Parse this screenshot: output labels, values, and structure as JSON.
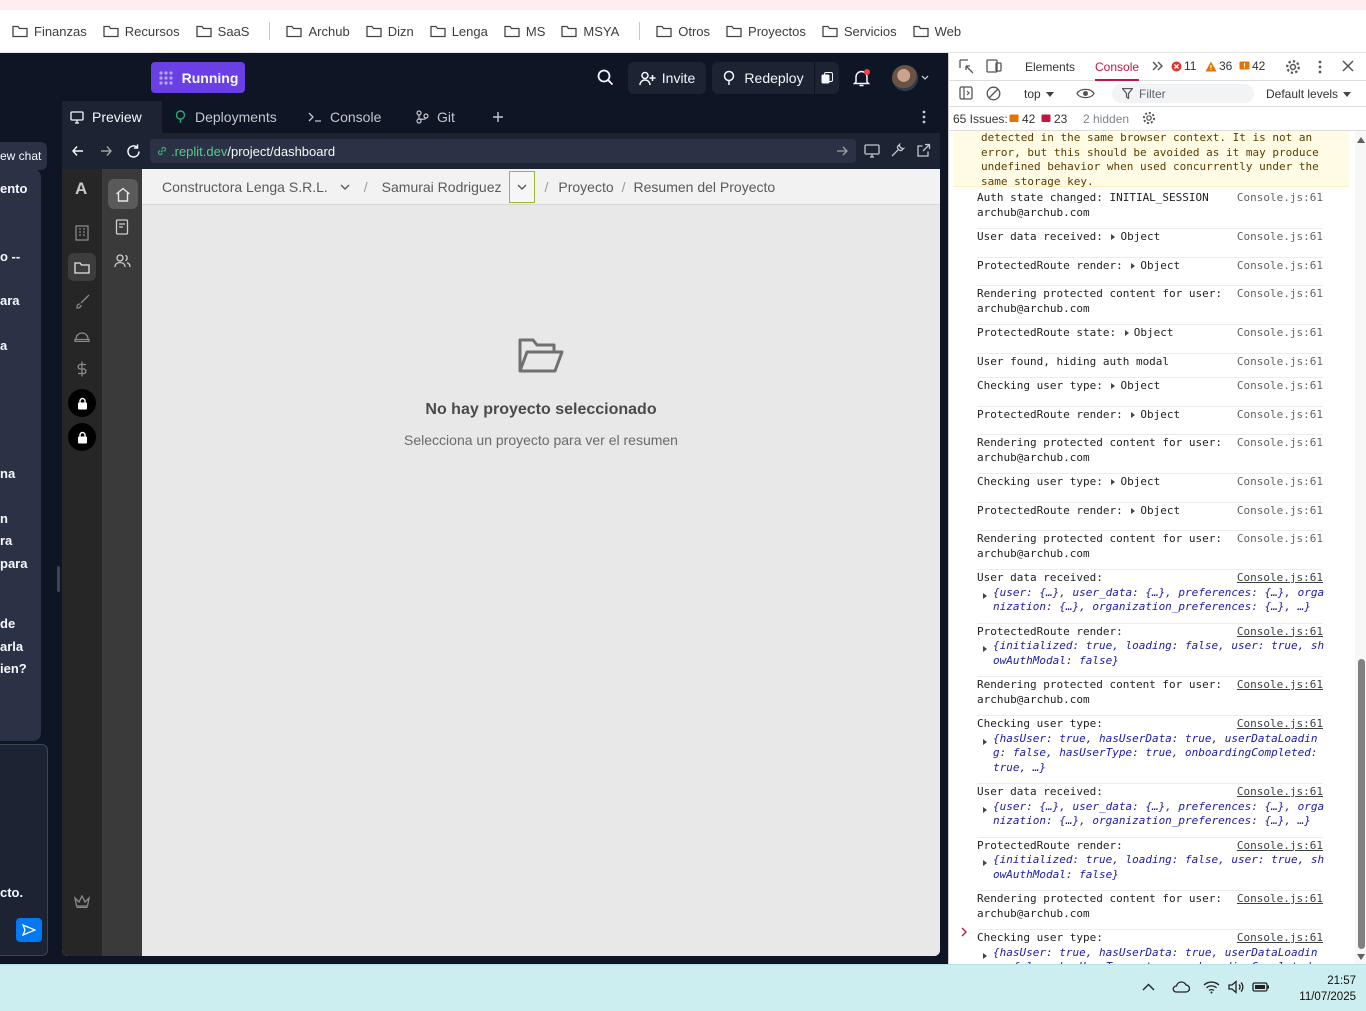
{
  "bookmarks": {
    "items": [
      "Finanzas",
      "Recursos",
      "SaaS",
      "Archub",
      "Dizn",
      "Lenga",
      "MS",
      "MSYA",
      "Otros",
      "Proyectos",
      "Servicios",
      "Web"
    ]
  },
  "replit": {
    "status_label": "Running",
    "invite_label": "Invite",
    "redeploy_label": "Redeploy",
    "tabs": [
      "Preview",
      "Deployments",
      "Console",
      "Git"
    ],
    "url_domain": ".replit.dev",
    "url_path": "/project/dashboard",
    "chat": {
      "new_chat": "ew chat",
      "fragments": [
        "ento",
        "o --",
        "ara",
        "a",
        "na",
        "n",
        "ra",
        "para",
        "de",
        "arla",
        "ien?",
        "cto."
      ]
    }
  },
  "app": {
    "sidebar_letter": "A",
    "avatar_letter": "A",
    "breadcrumb": {
      "org": "Constructora Lenga S.R.L.",
      "client": "Samurai Rodriguez",
      "section": "Proyecto",
      "page": "Resumen del Proyecto"
    },
    "empty_title": "No hay proyecto seleccionado",
    "empty_subtitle": "Selecciona un proyecto para ver el resumen"
  },
  "devtools": {
    "tabs": [
      "Elements",
      "Console"
    ],
    "errors": "11",
    "warnings": "36",
    "info": "42",
    "context": "top",
    "filter_placeholder": "Filter",
    "levels": "Default levels",
    "issues_label": "65 Issues:",
    "issues_a": "42",
    "issues_b": "23",
    "hidden": "2 hidden",
    "warning_text": "detected in the same browser context. It is not an\nerror, but this should be avoided as it may produce\nundefined behavior when used concurrently under the\nsame storage key.",
    "source": "Console.js:61",
    "logs": [
      {
        "text": "Auth state changed: INITIAL_SESSION\narchub@archub.com"
      },
      {
        "text": "User data received:",
        "obj": "Object"
      },
      {
        "text": "ProtectedRoute render:",
        "obj": "Object"
      },
      {
        "text": "Rendering protected content for user:\narchub@archub.com"
      },
      {
        "text": "ProtectedRoute state:",
        "obj": "Object"
      },
      {
        "text": "User found, hiding auth modal"
      },
      {
        "text": "Checking user type:",
        "obj": "Object"
      },
      {
        "text": "ProtectedRoute render:",
        "obj": "Object"
      },
      {
        "text": "Rendering protected content for user:\narchub@archub.com"
      },
      {
        "text": "Checking user type:",
        "obj": "Object"
      },
      {
        "text": "ProtectedRoute render:",
        "obj": "Object"
      },
      {
        "text": "Rendering protected content for user:\narchub@archub.com"
      }
    ],
    "expanded": [
      {
        "text": "User data received:",
        "detail": "{user: {…}, user_data: {…}, preferences: {…}, orga\nnization: {…}, organization_preferences: {…}, …}"
      },
      {
        "text": "ProtectedRoute render:",
        "detail": "{initialized: true, loading: false, user: true, sh\nowAuthModal: false}"
      },
      {
        "text": "Rendering protected content for user:\narchub@archub.com"
      },
      {
        "text": "Checking user type:",
        "detail": "{hasUser: true, hasUserData: true, userDataLoadin\ng: false, hasUserType: true, onboardingCompleted:\ntrue, …}"
      },
      {
        "text": "User data received:",
        "detail": "{user: {…}, user_data: {…}, preferences: {…}, orga\nnization: {…}, organization_preferences: {…}, …}"
      },
      {
        "text": "ProtectedRoute render:",
        "detail": "{initialized: true, loading: false, user: true, sh\nowAuthModal: false}"
      },
      {
        "text": "Rendering protected content for user:\narchub@archub.com"
      },
      {
        "text": "Checking user type:",
        "detail": "{hasUser: true, hasUserData: true, userDataLoadin\ng: false, hasUserType: true, onboardingCompleted:\ntrue, …}"
      }
    ]
  },
  "taskbar": {
    "time": "21:57",
    "date": "11/07/2025"
  }
}
